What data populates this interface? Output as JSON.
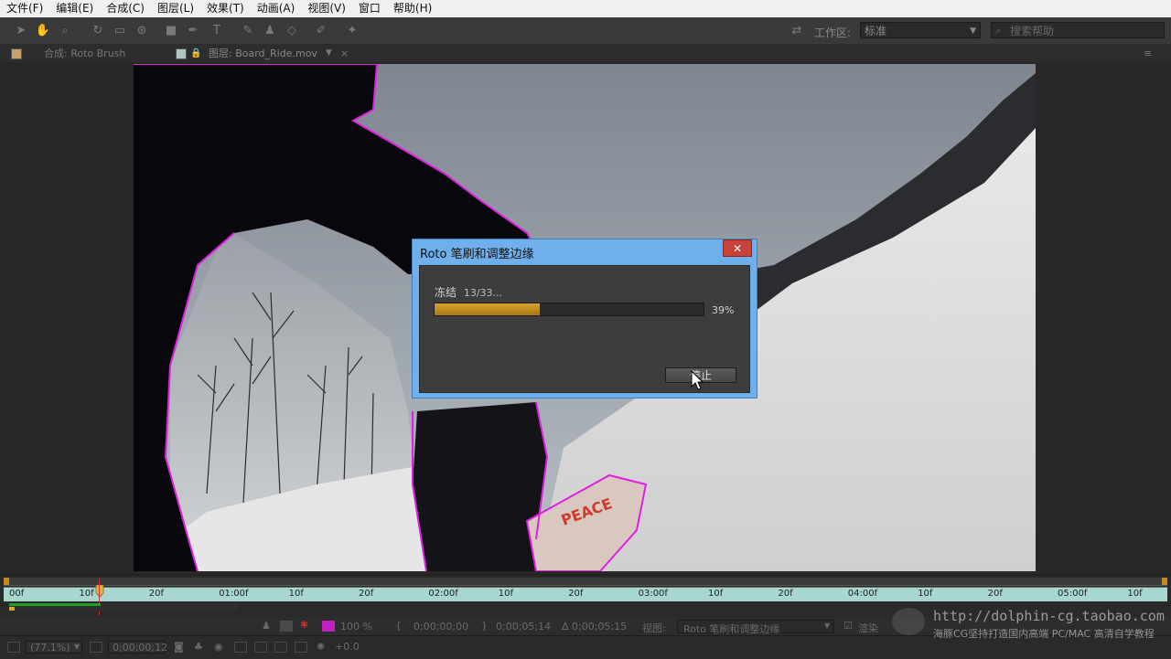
{
  "menu": {
    "items": [
      "文件(F)",
      "编辑(E)",
      "合成(C)",
      "图层(L)",
      "效果(T)",
      "动画(A)",
      "视图(V)",
      "窗口",
      "帮助(H)"
    ]
  },
  "toolbar": {
    "workspace_label": "工作区:",
    "workspace_value": "标准",
    "search_placeholder": "搜索帮助"
  },
  "tabs": {
    "composition": "合成: Roto Brush",
    "layer": "图层: Board_Ride.mov"
  },
  "dialog": {
    "title": "Roto 笔刷和调整边缘",
    "status_label": "冻结",
    "status_frames": "13/33...",
    "progress": 0.39,
    "progress_text": "39%",
    "stop_label": "停止",
    "accent": "#6fb0ec"
  },
  "timeline": {
    "ticks": [
      "00f",
      "10f",
      "20f",
      "01:00f",
      "10f",
      "20f",
      "02:00f",
      "10f",
      "20f",
      "03:00f",
      "10f",
      "20f",
      "04:00f",
      "10f",
      "20f",
      "05:00f",
      "10f"
    ]
  },
  "controls": {
    "zoom_pct": "100 %",
    "start_time": "0;00;00;00",
    "end_time": "0;00;05;14",
    "duration": "Δ 0;00;05;15",
    "view_label": "视图:",
    "view_value": "Roto 笔刷和调整边缘",
    "render_label": "渲染"
  },
  "bottombar": {
    "magnification": "(77.1%)",
    "timecode": "0;00;00;12",
    "exposure": "+0.0"
  },
  "watermark": {
    "url": "http://dolphin-cg.taobao.com",
    "tagline": "海豚CG坚持打造国内高端 PC/MAC 高清自学教程"
  }
}
